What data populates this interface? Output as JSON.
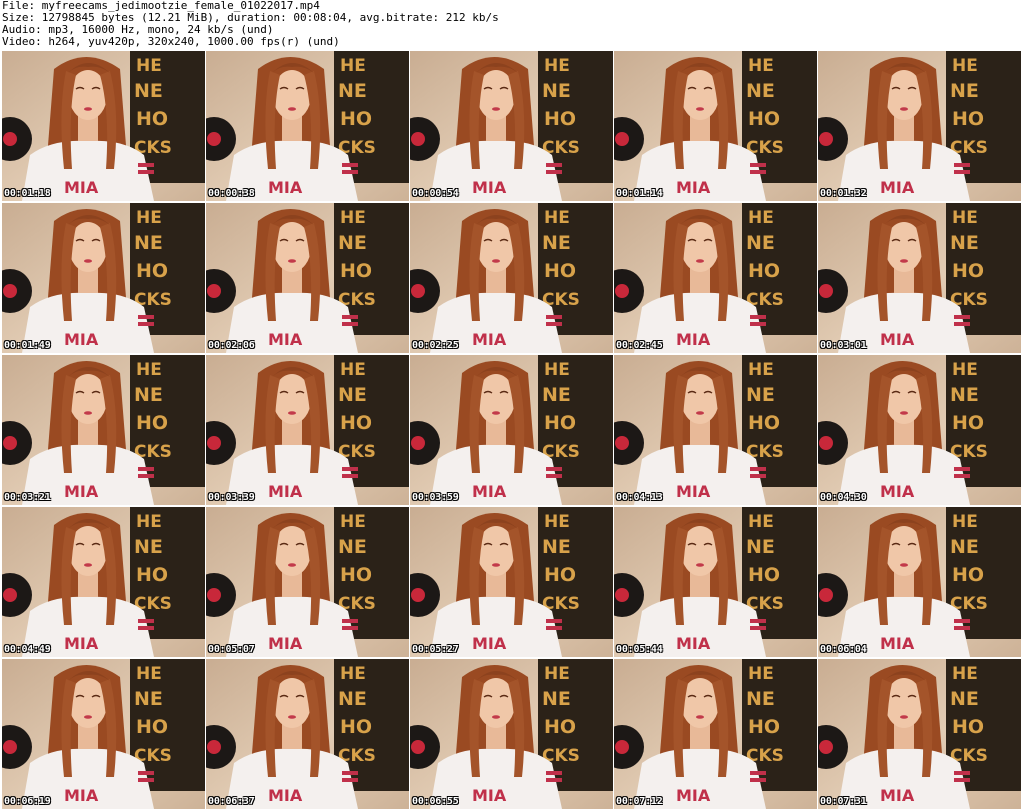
{
  "header": {
    "file_line": "File: myfreecams_jedimootzie_female_01022017.mp4",
    "size_line": "Size: 12798845 bytes (12.21 MiB), duration: 00:08:04, avg.bitrate: 212 kb/s",
    "audio_line": "Audio: mp3, 16000 Hz, mono, 24 kb/s (und)",
    "video_line": "Video: h264, yuv420p, 320x240, 1000.00 fps(r) (und)"
  },
  "colors": {
    "background": "#ffffff",
    "wall": "#d9c0a4",
    "poster": "#2b2218",
    "poster_text": "#d8a24a",
    "hair": "#9a4a22",
    "skin": "#f0c7a8",
    "shirt": "#f4f0ee",
    "shirt_text": "#c0304a",
    "record": "#1c1816",
    "record_label": "#c8283a",
    "timestamp": "#ffffff"
  },
  "thumbnails": [
    {
      "timestamp": "00:01:18"
    },
    {
      "timestamp": "00:00:38"
    },
    {
      "timestamp": "00:00:54"
    },
    {
      "timestamp": "00:01:14"
    },
    {
      "timestamp": "00:01:32"
    },
    {
      "timestamp": "00:01:49"
    },
    {
      "timestamp": "00:02:06"
    },
    {
      "timestamp": "00:02:25"
    },
    {
      "timestamp": "00:02:45"
    },
    {
      "timestamp": "00:03:01"
    },
    {
      "timestamp": "00:03:21"
    },
    {
      "timestamp": "00:03:39"
    },
    {
      "timestamp": "00:03:59"
    },
    {
      "timestamp": "00:04:13"
    },
    {
      "timestamp": "00:04:30"
    },
    {
      "timestamp": "00:04:49"
    },
    {
      "timestamp": "00:05:07"
    },
    {
      "timestamp": "00:05:27"
    },
    {
      "timestamp": "00:05:44"
    },
    {
      "timestamp": "00:06:04"
    },
    {
      "timestamp": "00:06:19"
    },
    {
      "timestamp": "00:06:37"
    },
    {
      "timestamp": "00:06:55"
    },
    {
      "timestamp": "00:07:12"
    },
    {
      "timestamp": "00:07:31"
    }
  ]
}
